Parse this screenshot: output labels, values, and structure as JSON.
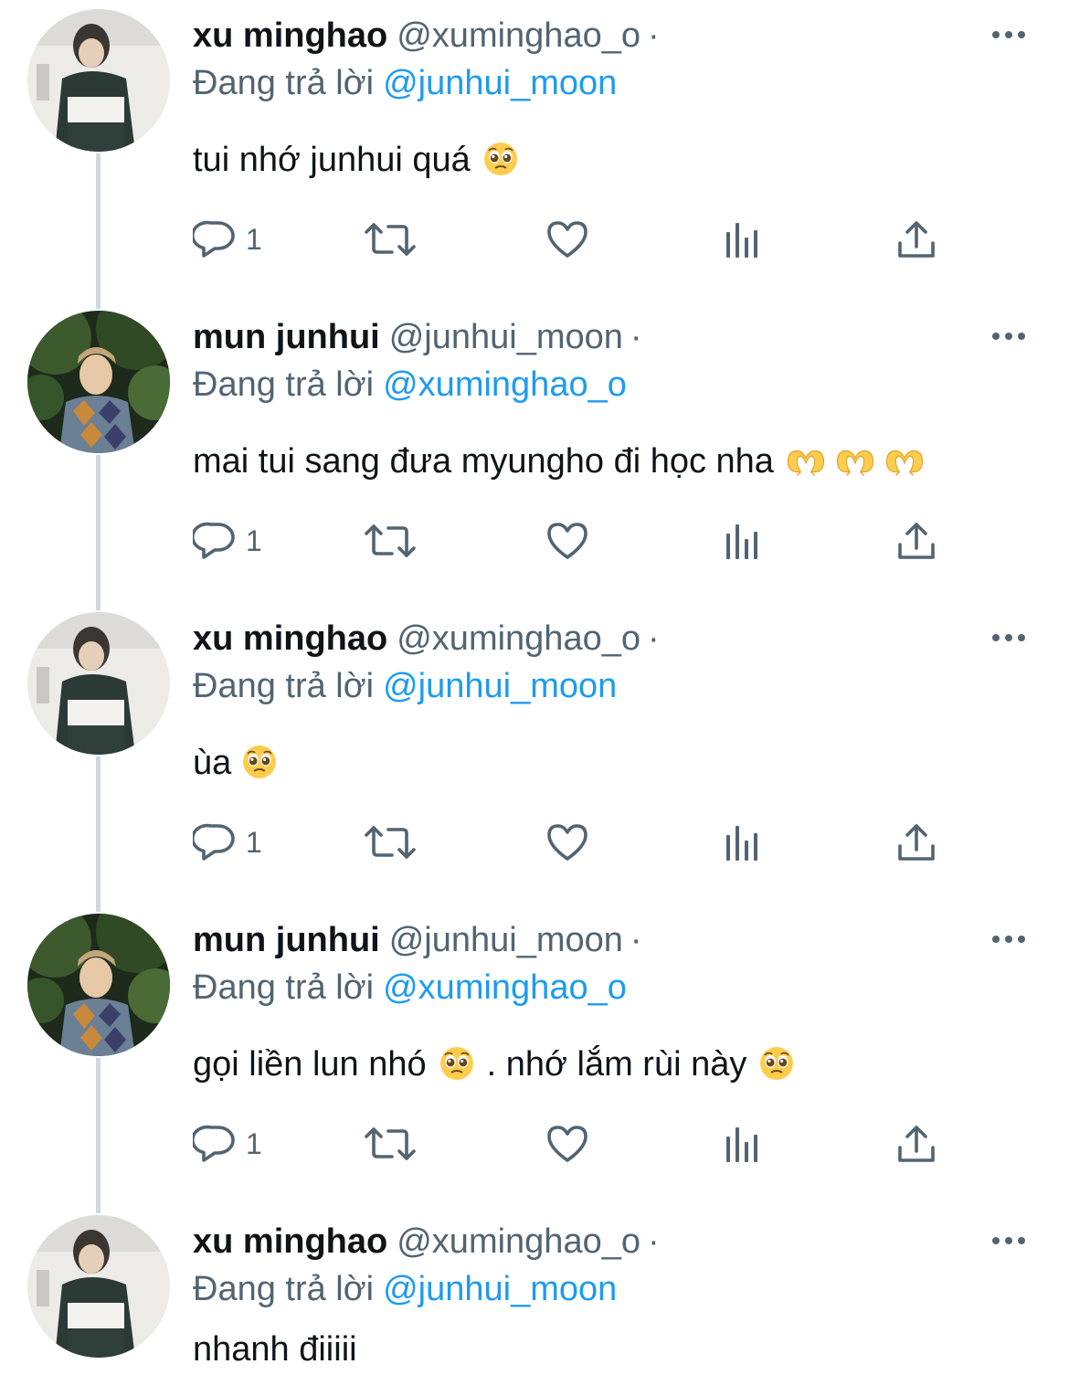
{
  "colors": {
    "text": "#0f1419",
    "secondary": "#536471",
    "link": "#1d9bf0",
    "thread_line": "#cfd9de"
  },
  "tweets": [
    {
      "display_name": "xu minghao",
      "handle": "@xuminghao_o",
      "separator": "·",
      "reply_prefix": "Đang trả lời",
      "reply_to": "@junhui_moon",
      "text": "tui nhớ junhui quá",
      "reply_count": "1",
      "avatar": "avatar-minghao"
    },
    {
      "display_name": "mun junhui",
      "handle": "@junhui_moon",
      "separator": "·",
      "reply_prefix": "Đang trả lời",
      "reply_to": "@xuminghao_o",
      "text": "mai tui sang đưa myungho đi học nha",
      "reply_count": "1",
      "avatar": "avatar-junhui"
    },
    {
      "display_name": "xu minghao",
      "handle": "@xuminghao_o",
      "separator": "·",
      "reply_prefix": "Đang trả lời",
      "reply_to": "@junhui_moon",
      "text": "ùa",
      "reply_count": "1",
      "avatar": "avatar-minghao"
    },
    {
      "display_name": "mun junhui",
      "handle": "@junhui_moon",
      "separator": "·",
      "reply_prefix": "Đang trả lời",
      "reply_to": "@xuminghao_o",
      "text_part1": "gọi liền lun nhó",
      "text_part2": ". nhớ lắm rùi này",
      "reply_count": "1",
      "avatar": "avatar-junhui"
    },
    {
      "display_name": "xu minghao",
      "handle": "@xuminghao_o",
      "separator": "·",
      "reply_prefix": "Đang trả lời",
      "reply_to": "@junhui_moon",
      "text": "nhanh điiiii",
      "avatar": "avatar-minghao"
    }
  ],
  "icons": [
    "reply-icon",
    "retweet-icon",
    "like-icon",
    "analytics-icon",
    "share-icon",
    "more-icon",
    "pleading-face-emoji",
    "heart-hands-emoji"
  ]
}
